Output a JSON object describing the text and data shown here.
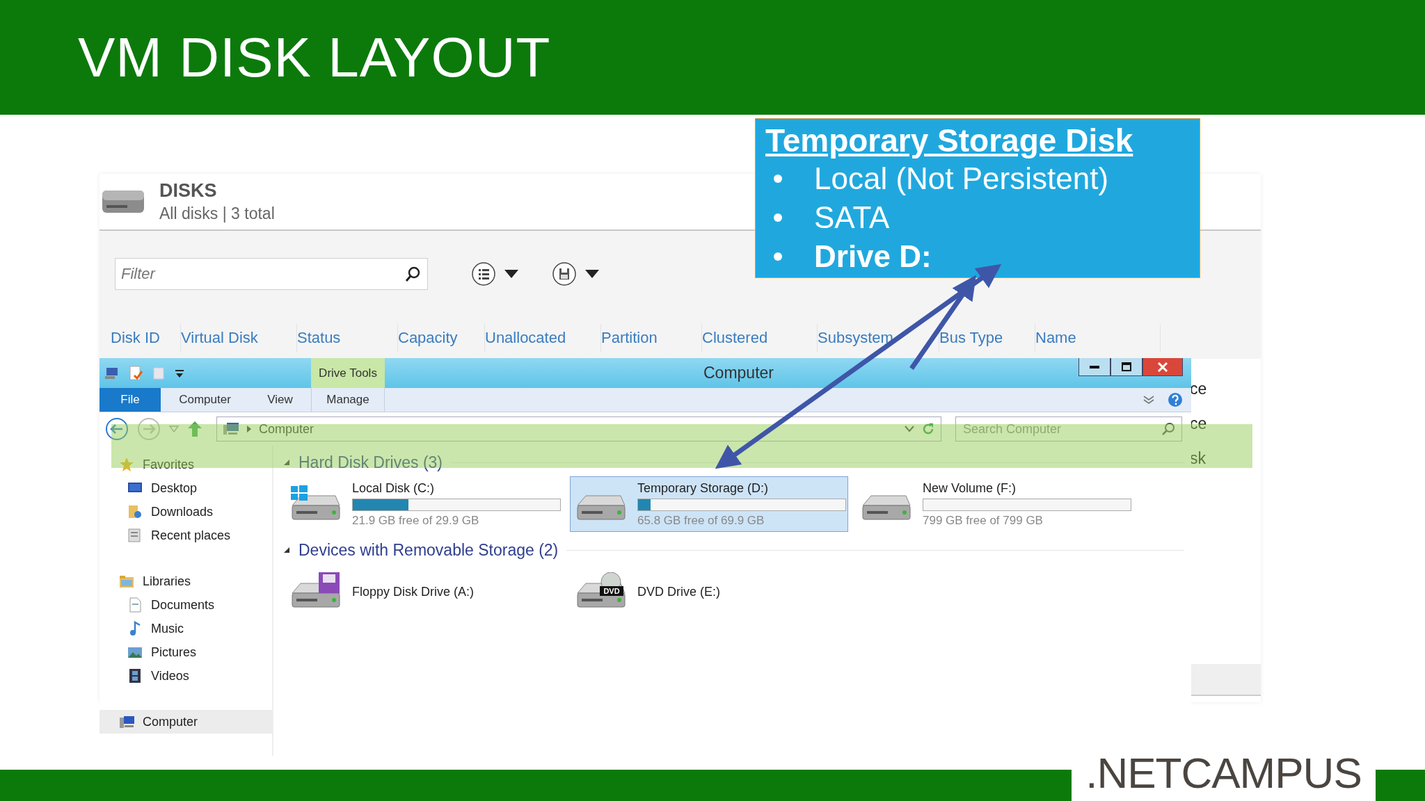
{
  "slide": {
    "title": "VM DISK LAYOUT",
    "logo": ".NETCAMPUS"
  },
  "server_manager": {
    "title": "DISKS",
    "subtitle": "All disks | 3 total",
    "filter": {
      "placeholder": "Filter"
    },
    "columns": [
      "Disk ID",
      "Virtual Disk",
      "Status",
      "Capacity",
      "Unallocated",
      "Partition",
      "Clustered",
      "Subsystem",
      "Bus Type",
      "Name"
    ],
    "partial_cells": [
      "ce",
      "ce",
      "sk"
    ]
  },
  "explorer": {
    "title": "Computer",
    "context_tab": "Drive Tools",
    "tabs": [
      {
        "label": "File",
        "kind": "file",
        "selected": false
      },
      {
        "label": "Computer",
        "kind": "tab",
        "selected": false
      },
      {
        "label": "View",
        "kind": "tab",
        "selected": false
      },
      {
        "label": "Manage",
        "kind": "context",
        "selected": false
      }
    ],
    "address": "Computer",
    "search": {
      "placeholder": "Search Computer"
    },
    "nav": [
      {
        "label": "Favorites",
        "selected": false,
        "children": [
          {
            "label": "Desktop",
            "selected": false
          },
          {
            "label": "Downloads",
            "selected": false
          },
          {
            "label": "Recent places",
            "selected": false
          }
        ]
      },
      {
        "label": "Libraries",
        "selected": false,
        "children": [
          {
            "label": "Documents",
            "selected": false
          },
          {
            "label": "Music",
            "selected": false
          },
          {
            "label": "Pictures",
            "selected": false
          },
          {
            "label": "Videos",
            "selected": false
          }
        ]
      },
      {
        "label": "Computer",
        "selected": true
      }
    ],
    "sections": [
      {
        "title": "Hard Disk Drives (3)",
        "expanded": true,
        "items": [
          {
            "kind": "system",
            "name": "Local Disk (C:)",
            "free": "21.9 GB free of 29.9 GB",
            "level": 0.27,
            "selected": false
          },
          {
            "kind": "disk",
            "name": "Temporary Storage (D:)",
            "free": "65.8 GB free of 69.9 GB",
            "level": 0.06,
            "selected": true
          },
          {
            "kind": "disk",
            "name": "New Volume (F:)",
            "free": "799 GB free of 799 GB",
            "level": 0,
            "selected": false
          }
        ]
      },
      {
        "title": "Devices with Removable Storage (2)",
        "expanded": true,
        "items": [
          {
            "kind": "floppy",
            "name": "Floppy Disk Drive (A:)",
            "selected": false
          },
          {
            "kind": "dvd",
            "name": "DVD Drive (E:)",
            "badge": "DVD",
            "selected": false
          }
        ]
      }
    ]
  },
  "callout": {
    "title": "Temporary Storage Disk",
    "bullets": [
      {
        "text": "Local (Not Persistent)",
        "bold": false
      },
      {
        "text": "SATA",
        "bold": false
      },
      {
        "text": "Drive D:",
        "bold": true
      }
    ]
  }
}
